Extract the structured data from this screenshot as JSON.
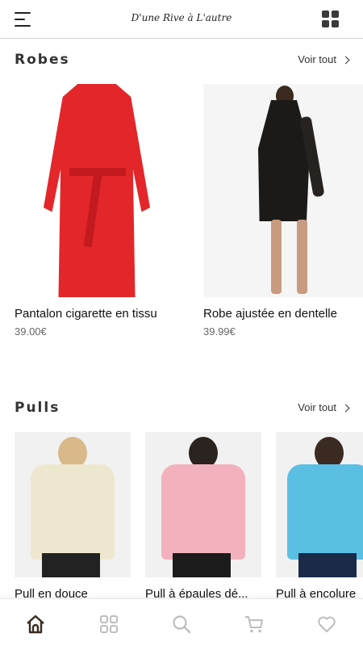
{
  "header": {
    "brand": "D'une Rive à L'autre"
  },
  "sections": [
    {
      "title": "Robes",
      "see_all": "Voir tout",
      "products": [
        {
          "name": "Pantalon cigarette en tissu",
          "price": "39.00€"
        },
        {
          "name": "Robe ajustée en dentelle",
          "price": "39.99€"
        }
      ]
    },
    {
      "title": "Pulls",
      "see_all": "Voir tout",
      "products": [
        {
          "name": "Pull en douce",
          "price": ""
        },
        {
          "name": "Pull à épaules dé...",
          "price": ""
        },
        {
          "name": "Pull à encolure",
          "price": ""
        }
      ]
    }
  ],
  "bottom_nav": [
    "home-icon",
    "categories-icon",
    "search-icon",
    "cart-icon",
    "favorites-icon"
  ],
  "colors": {
    "accent": "#3a2a20",
    "text": "#222222",
    "muted": "#666666"
  }
}
